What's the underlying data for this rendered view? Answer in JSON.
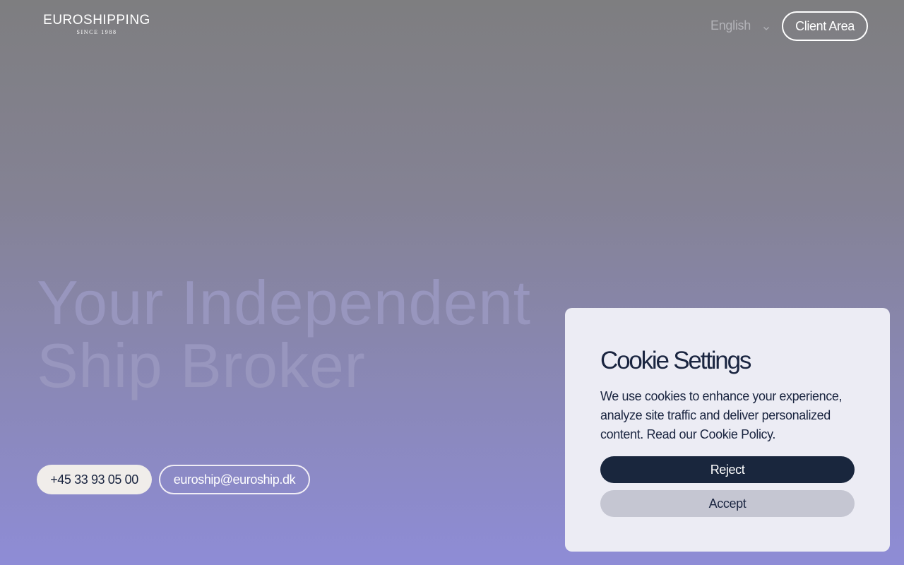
{
  "header": {
    "logo_main": "EUROSHIPPING",
    "logo_sub": "SINCE 1988",
    "language": {
      "selected": "English",
      "icon": "chevron-down-icon"
    },
    "client_area_label": "Client Area"
  },
  "hero": {
    "title_line1": "Your Independent",
    "title_line2": "Ship Broker",
    "phone": "+45 33 93 05 00",
    "email": "euroship@euroship.dk"
  },
  "cookie": {
    "title": "Cookie Settings",
    "text": "We use cookies to enhance your experience, analyze site traffic and deliver personalized content. Read our ",
    "policy_link": "Cookie Policy",
    "text_end": ".",
    "reject_label": "Reject",
    "accept_label": "Accept"
  },
  "colors": {
    "navy": "#19263d",
    "panel_bg": "#ececf4",
    "accept_bg": "#c5c6d2",
    "phone_bg": "#f0edea"
  }
}
